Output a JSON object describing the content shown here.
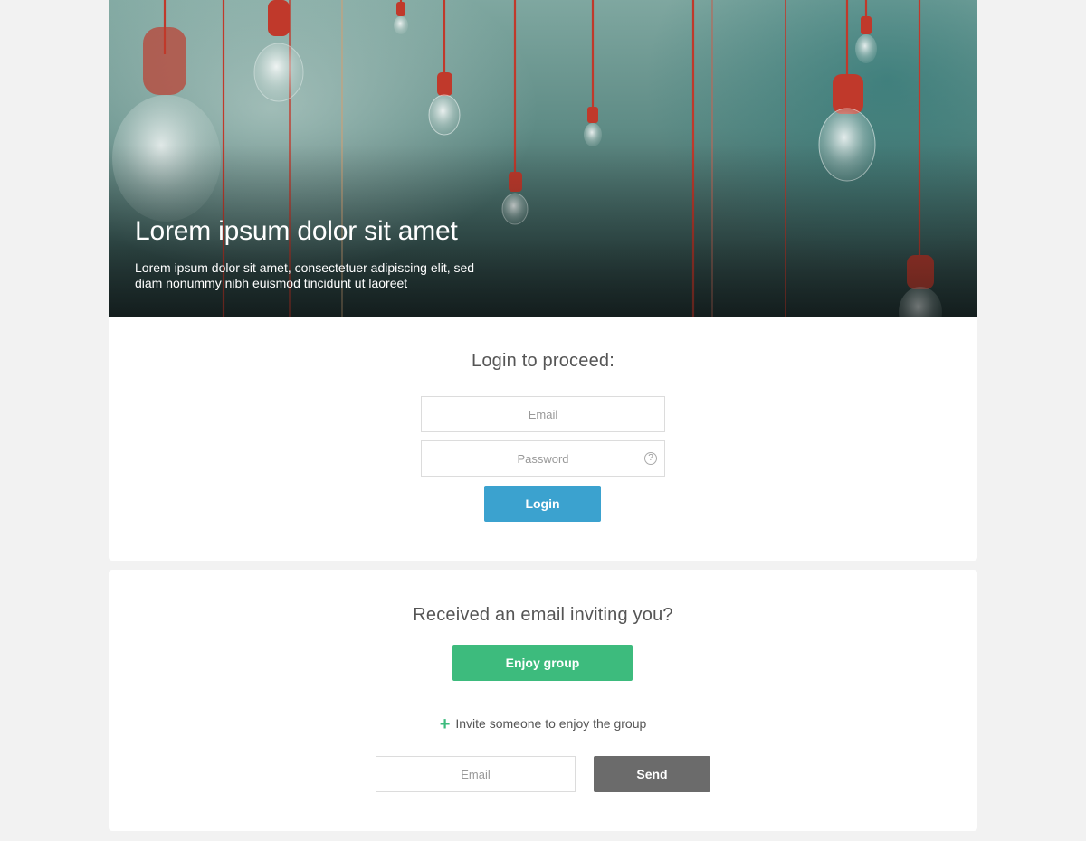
{
  "hero": {
    "title": "Lorem ipsum dolor sit amet",
    "subtitle": "Lorem ipsum dolor sit amet, consectetuer adipiscing elit, sed diam nonummy nibh euismod tincidunt ut laoreet"
  },
  "login": {
    "heading": "Login to proceed:",
    "email_placeholder": "Email",
    "password_placeholder": "Password",
    "help_icon": "question-circle-icon",
    "help_glyph": "?",
    "button_label": "Login"
  },
  "invite": {
    "heading": "Received an email inviting you?",
    "enjoy_button_label": "Enjoy group",
    "invite_icon": "plus-icon",
    "invite_glyph": "+",
    "invite_link_label": "Invite someone to enjoy the group",
    "email_placeholder": "Email",
    "send_button_label": "Send"
  },
  "colors": {
    "login_button": "#3ba2cf",
    "enjoy_button": "#3dbb7d",
    "send_button": "#6b6b6b",
    "background": "#f2f2f2"
  }
}
